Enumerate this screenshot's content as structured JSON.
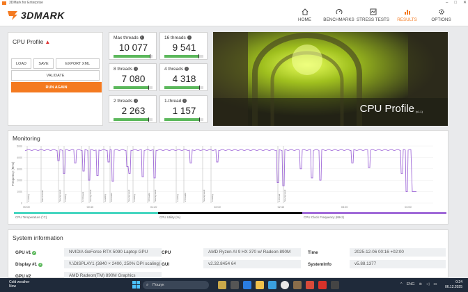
{
  "window": {
    "title": "3DMark for Enterprise"
  },
  "app": {
    "logo_text": "3DMARK"
  },
  "nav": [
    {
      "label": "HOME",
      "icon": "home-icon"
    },
    {
      "label": "BENCHMARKS",
      "icon": "benchmarks-icon"
    },
    {
      "label": "STRESS TESTS",
      "icon": "stress-tests-icon"
    },
    {
      "label": "RESULTS",
      "icon": "results-icon",
      "active": true
    },
    {
      "label": "OPTIONS",
      "icon": "gear-icon"
    }
  ],
  "profile": {
    "title": "CPU Profile",
    "load": "LOAD",
    "save": "SAVE",
    "export": "EXPORT XML",
    "validate": "VALIDATE",
    "run": "RUN AGAIN"
  },
  "scores": [
    {
      "label": "Max threads",
      "value": "10 077",
      "fill": 0.92
    },
    {
      "label": "16 threads",
      "value": "9 541",
      "fill": 0.88
    },
    {
      "label": "8 threads",
      "value": "7 080",
      "fill": 0.9
    },
    {
      "label": "4 threads",
      "value": "4 318",
      "fill": 0.9
    },
    {
      "label": "2 threads",
      "value": "2 263",
      "fill": 0.9
    },
    {
      "label": "1-thread",
      "value": "1 157",
      "fill": 0.9
    }
  ],
  "hero": {
    "title": "CPU Profile",
    "version": "(v1.1)"
  },
  "monitoring": {
    "title": "Monitoring",
    "ylabel": "Frequency (MHz)",
    "yticks": [
      "5000",
      "4000",
      "3000",
      "2000",
      "1000",
      "0"
    ],
    "xticks": [
      "00:00",
      "00:40",
      "01:20",
      "02:00",
      "02:40",
      "03:20",
      "04:00"
    ],
    "markers": [
      "Loading",
      "Max threads",
      "Saving result",
      "Loading",
      "16 threads",
      "Saving result",
      "Loading",
      "8 threads",
      "Saving result",
      "Loading",
      "4 threads",
      "Saving result",
      "Loading",
      "2 threads",
      "Saving result",
      "Loading",
      "1-thread",
      "Saving result"
    ],
    "legend": [
      "CPU Temperature (°C)",
      "CPU Utility (%)",
      "CPU Clock Frequency (MHz)"
    ],
    "legend_colors": [
      "#46d6c0",
      "#111111",
      "#a06ad8"
    ]
  },
  "system": {
    "title": "System information",
    "gpu1_label": "GPU #1",
    "gpu1_value": "NVIDIA GeForce RTX 5090 Laptop GPU",
    "display1_label": "Display #1",
    "display1_value": "\\\\.\\DISPLAY1 (3840 × 2400, 250% DPI scaling)",
    "gpu2_label": "GPU #2",
    "gpu2_value": "AMD Radeon(TM) 890M Graphics",
    "cpu_label": "CPU",
    "cpu_value": "AMD Ryzen AI 9 HX 370 w/ Radeon 890M",
    "gui_label": "GUI",
    "gui_value": "v2.32.8454 64",
    "time_label": "Time",
    "time_value": "2025-12-06 00:16 +02:00",
    "sysinfo_label": "SystemInfo",
    "sysinfo_value": "v5.88.1377"
  },
  "taskbar": {
    "weather_title": "Cold weather",
    "weather_sub": "Now",
    "search": "Пошук",
    "lang": "ENG",
    "time": "0:24",
    "date": "06.12.2025"
  }
}
